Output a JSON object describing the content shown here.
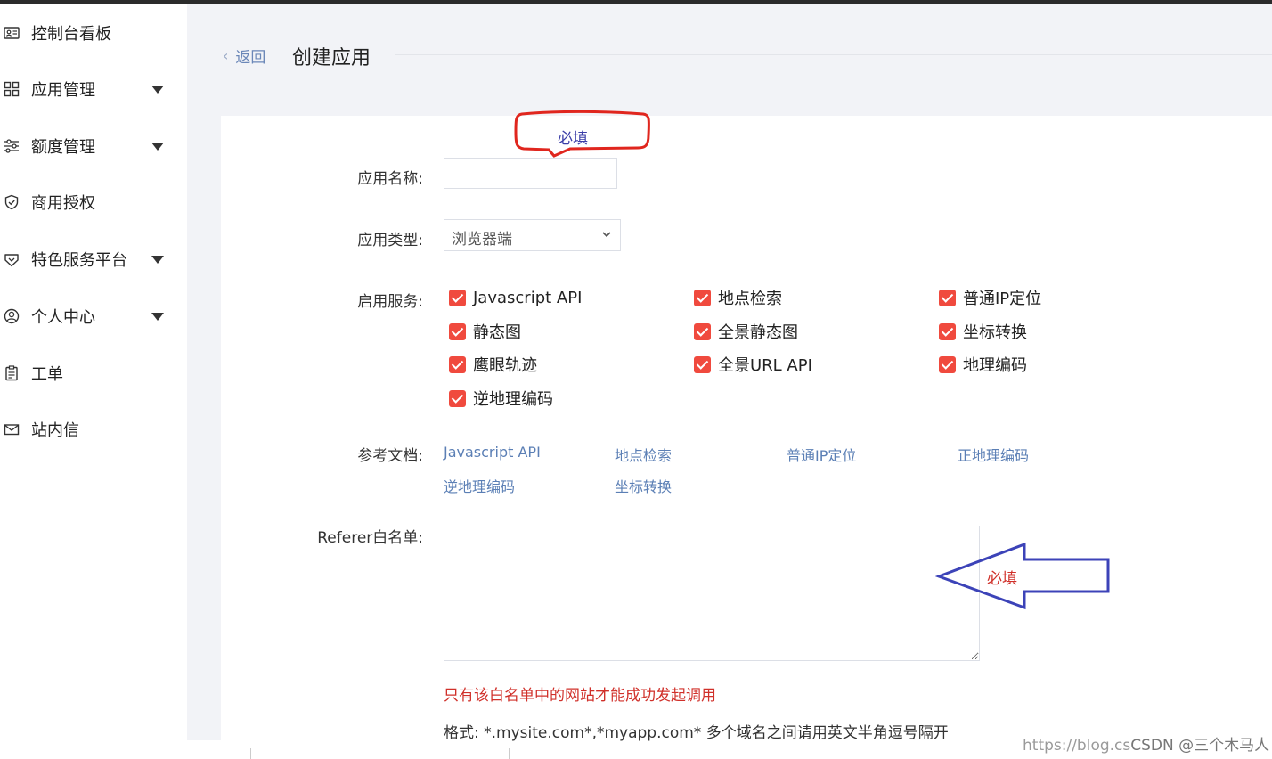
{
  "sidebar": {
    "items": [
      {
        "label": "控制台看板",
        "icon": "id-card-icon",
        "caret": false
      },
      {
        "label": "应用管理",
        "icon": "grid-icon",
        "caret": true
      },
      {
        "label": "额度管理",
        "icon": "sliders-icon",
        "caret": true
      },
      {
        "label": "商用授权",
        "icon": "shield-check-icon",
        "caret": false
      },
      {
        "label": "特色服务平台",
        "icon": "gem-icon",
        "caret": true
      },
      {
        "label": "个人中心",
        "icon": "user-circle-icon",
        "caret": true
      },
      {
        "label": "工单",
        "icon": "clipboard-icon",
        "caret": false
      },
      {
        "label": "站内信",
        "icon": "mail-icon",
        "caret": false
      }
    ]
  },
  "header": {
    "back_label": "返回",
    "title": "创建应用"
  },
  "form": {
    "name_label": "应用名称:",
    "name_value": "",
    "type_label": "应用类型:",
    "type_value": "浏览器端",
    "services_label": "启用服务:",
    "services": [
      "Javascript API",
      "地点检索",
      "普通IP定位",
      "静态图",
      "全景静态图",
      "坐标转换",
      "鹰眼轨迹",
      "全景URL API",
      "地理编码",
      "逆地理编码"
    ],
    "docs_label": "参考文档:",
    "docs": [
      "Javascript API",
      "地点检索",
      "普通IP定位",
      "正地理编码",
      "逆地理编码",
      "坐标转换"
    ],
    "referer_label": "Referer白名单:",
    "referer_value": "",
    "referer_hint": "只有该白名单中的网站才能成功发起调用",
    "referer_format": "格式: *.mysite.com*,*myapp.com* 多个域名之间请用英文半角逗号隔开"
  },
  "annotations": {
    "top_note": "必填",
    "arrow_note": "必填"
  },
  "watermark": {
    "faint": "https://blog.cs",
    "brand": "CSDN @三个木马人"
  },
  "colors": {
    "checkbox": "#f04a3e",
    "link": "#5b7fb5",
    "annotation_blue": "#3b3ea8",
    "annotation_red": "#d0302a"
  }
}
